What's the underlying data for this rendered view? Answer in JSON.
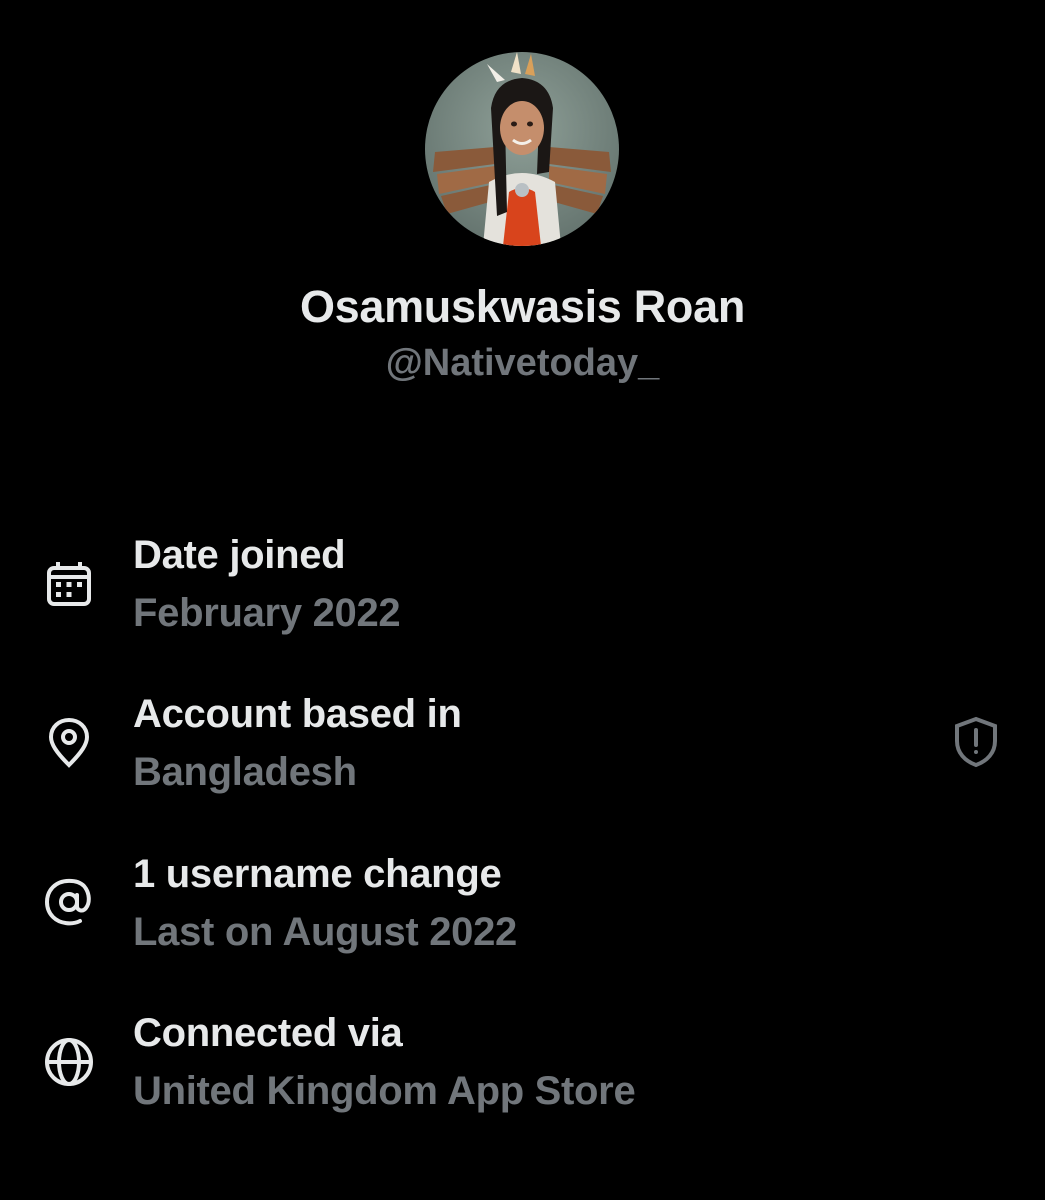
{
  "profile": {
    "display_name": "Osamuskwasis Roan",
    "handle": "@Nativetoday_"
  },
  "details": [
    {
      "icon": "calendar-icon",
      "label": "Date joined",
      "value": "February 2022"
    },
    {
      "icon": "location-pin-icon",
      "label": "Account based in",
      "value": "Bangladesh",
      "trailing_icon": "shield-alert-icon"
    },
    {
      "icon": "at-sign-icon",
      "label": "1 username change",
      "value": "Last on August 2022"
    },
    {
      "icon": "globe-icon",
      "label": "Connected via",
      "value": "United Kingdom App Store"
    }
  ],
  "colors": {
    "background": "#000000",
    "primary_text": "#e7e9ea",
    "secondary_text": "#71767b"
  }
}
